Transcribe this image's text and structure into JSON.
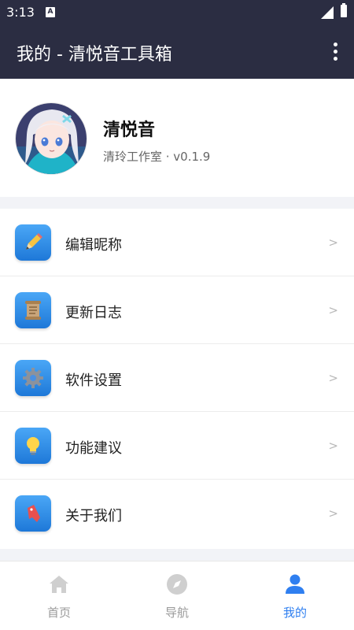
{
  "status_bar": {
    "time": "3:13",
    "notification_letter": "A"
  },
  "app_bar": {
    "title": "我的 - 清悦音工具箱",
    "more_icon": "more-vert-icon"
  },
  "profile": {
    "name": "清悦音",
    "subtitle": "清玲工作室 · v0.1.9",
    "avatar_description_icon": "avatar-anime-character"
  },
  "menu": {
    "items": [
      {
        "label": "编辑昵称",
        "icon": "pencil-icon",
        "chevron": ">"
      },
      {
        "label": "更新日志",
        "icon": "scroll-icon",
        "chevron": ">"
      },
      {
        "label": "软件设置",
        "icon": "gear-icon",
        "chevron": ">"
      },
      {
        "label": "功能建议",
        "icon": "lightbulb-icon",
        "chevron": ">"
      },
      {
        "label": "关于我们",
        "icon": "bookmark-icon",
        "chevron": ">"
      }
    ]
  },
  "bottom_nav": {
    "items": [
      {
        "label": "首页",
        "icon": "home-icon",
        "active": false
      },
      {
        "label": "导航",
        "icon": "compass-icon",
        "active": false
      },
      {
        "label": "我的",
        "icon": "person-icon",
        "active": true
      }
    ]
  },
  "colors": {
    "app_bar": "#2b2d42",
    "accent": "#2f7ff0",
    "icon_tile": "#2b8ae8",
    "background": "#f2f3f7"
  }
}
